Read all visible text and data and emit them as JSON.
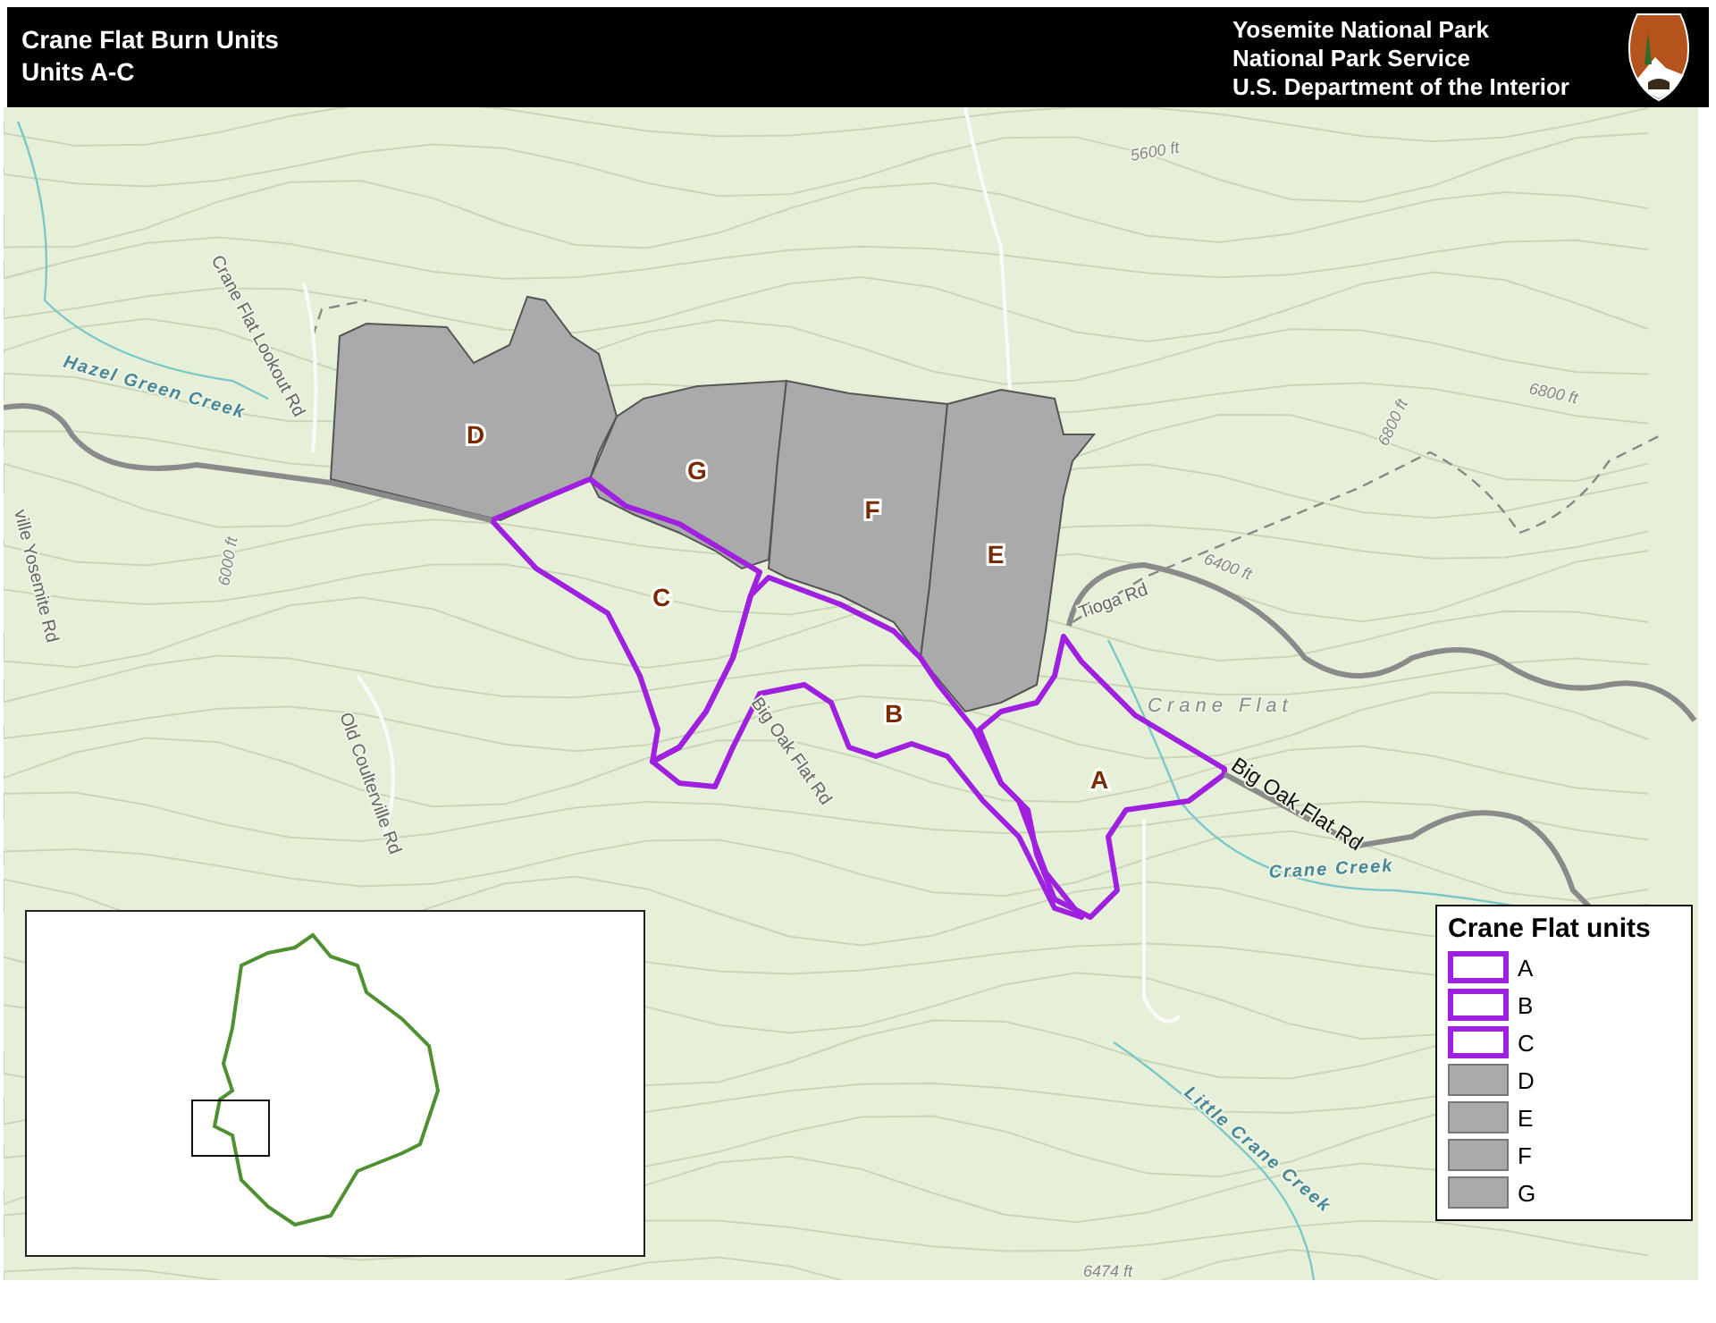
{
  "header": {
    "title": "Crane Flat Burn Units",
    "subtitle": "Units A-C",
    "agency_lines": [
      "Yosemite National Park",
      "National Park Service",
      "U.S. Department of the Interior"
    ]
  },
  "map": {
    "unit_labels": [
      {
        "label": "D",
        "kind": "fill"
      },
      {
        "label": "G",
        "kind": "fill"
      },
      {
        "label": "F",
        "kind": "fill"
      },
      {
        "label": "E",
        "kind": "fill"
      },
      {
        "label": "C",
        "kind": "outline"
      },
      {
        "label": "B",
        "kind": "outline"
      },
      {
        "label": "A",
        "kind": "outline"
      }
    ],
    "features": [
      {
        "text": "Hazel Green Creek",
        "kind": "creek"
      },
      {
        "text": "Crane Flat Lookout Rd",
        "kind": "minor_road"
      },
      {
        "text": "ville Yosemite Rd",
        "kind": "minor_road"
      },
      {
        "text": "6000 ft",
        "kind": "elevation"
      },
      {
        "text": "Old Coulterville Rd",
        "kind": "minor_road"
      },
      {
        "text": "Big Oak Flat Rd",
        "kind": "minor_road"
      },
      {
        "text": "5600 ft",
        "kind": "elevation"
      },
      {
        "text": "6800 ft",
        "kind": "elevation"
      },
      {
        "text": "6800 ft",
        "kind": "elevation"
      },
      {
        "text": "Tioga Rd",
        "kind": "minor_road"
      },
      {
        "text": "6400 ft",
        "kind": "elevation"
      },
      {
        "text": "Crane Flat",
        "kind": "place"
      },
      {
        "text": "Big Oak Flat Rd",
        "kind": "major_road"
      },
      {
        "text": "Crane Creek",
        "kind": "creek"
      },
      {
        "text": "Little Crane Creek",
        "kind": "creek"
      },
      {
        "text": "6474 ft",
        "kind": "elevation"
      }
    ]
  },
  "legend": {
    "title": "Crane Flat units",
    "items": [
      {
        "label": "A",
        "kind": "outline"
      },
      {
        "label": "B",
        "kind": "outline"
      },
      {
        "label": "C",
        "kind": "outline"
      },
      {
        "label": "D",
        "kind": "fill"
      },
      {
        "label": "E",
        "kind": "fill"
      },
      {
        "label": "F",
        "kind": "fill"
      },
      {
        "label": "G",
        "kind": "fill"
      }
    ]
  }
}
